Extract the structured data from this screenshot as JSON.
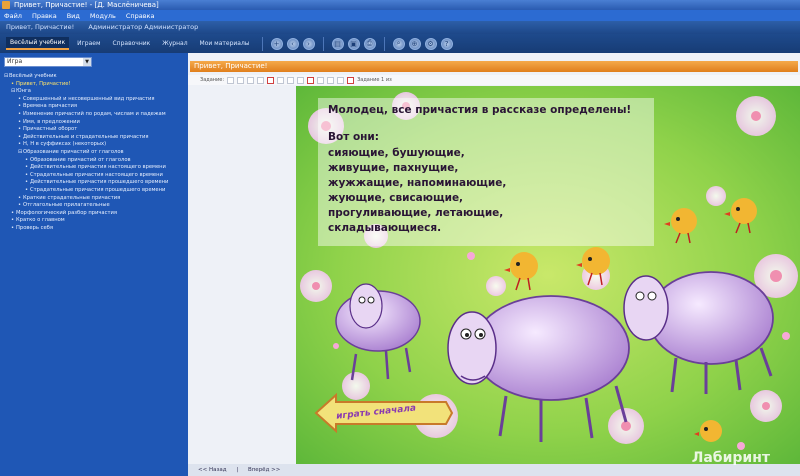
{
  "window": {
    "title": "Привет, Причастие! - [Д. Маслёничева]"
  },
  "menu": [
    "Файл",
    "Правка",
    "Вид",
    "Модуль",
    "Справка"
  ],
  "app_header": [
    "Привет, Причастие!",
    "Администратор Администратор"
  ],
  "toolbar": {
    "tabs": [
      "Весёлый учебник",
      "Играем",
      "Справочник",
      "Журнал",
      "Мои материалы"
    ],
    "icons": [
      "plus-icon",
      "back-icon",
      "forward-icon",
      "book-icon",
      "image-icon",
      "print-icon",
      "search-icon",
      "zoom-icon",
      "settings-icon",
      "help-icon"
    ]
  },
  "sidebar": {
    "select_value": "Игра",
    "items": [
      {
        "label": "Весёлый учебник",
        "level": 0,
        "hl": false
      },
      {
        "label": "Привет, Причастие!",
        "level": 1,
        "hl": true
      },
      {
        "label": "Юнга",
        "level": 1,
        "hl": false
      },
      {
        "label": "Совершенный и несовершенный вид причастия",
        "level": 2,
        "hl": false
      },
      {
        "label": "Времена причастия",
        "level": 2,
        "hl": false
      },
      {
        "label": "Изменение причастий по родам, числам и падежам",
        "level": 2,
        "hl": false
      },
      {
        "label": "Имя, в предложении",
        "level": 2,
        "hl": false
      },
      {
        "label": "Причастный оборот",
        "level": 2,
        "hl": false
      },
      {
        "label": "Действительные и страдательные причастия",
        "level": 2,
        "hl": false
      },
      {
        "label": "Н, Н в суффиксах (некоторых)",
        "level": 2,
        "hl": false
      },
      {
        "label": "Образование причастий от глаголов",
        "level": 2,
        "hl": false
      },
      {
        "label": "Образование причастий от глаголов",
        "level": 3,
        "hl": false
      },
      {
        "label": "Действительные причастия настоящего времени",
        "level": 3,
        "hl": false
      },
      {
        "label": "Страдательные причастия настоящего времени",
        "level": 3,
        "hl": false
      },
      {
        "label": "Действительные причастия прошедшего времени",
        "level": 3,
        "hl": false
      },
      {
        "label": "Страдательные причастия прошедшего времени",
        "level": 3,
        "hl": false
      },
      {
        "label": "Краткие страдательные причастия",
        "level": 2,
        "hl": false
      },
      {
        "label": "Отглагольные прилагательные",
        "level": 2,
        "hl": false
      },
      {
        "label": "Морфологический разбор причастия",
        "level": 1,
        "hl": false
      },
      {
        "label": "Кратко о главном",
        "level": 1,
        "hl": false
      },
      {
        "label": "Проверь себя",
        "level": 1,
        "hl": false
      }
    ]
  },
  "content": {
    "title": "Привет, Причастие!",
    "tools_label": "Задание:",
    "page_label": "Задание 1 из",
    "card": {
      "heading": "Молодец, все причастия в рассказе определены!",
      "sub": "Вот они:",
      "lines": [
        "сияющие, бушующие,",
        "живущие, пахнущие,",
        "жужжащие, напоминающие,",
        "жующие, свисающие,",
        "прогуливающие, летающие,",
        "складывающиеся."
      ]
    },
    "replay_button": "играть сначала",
    "status": [
      "<< Назад",
      "|",
      "Вперёд >>"
    ],
    "watermark": "Лабиринт"
  }
}
